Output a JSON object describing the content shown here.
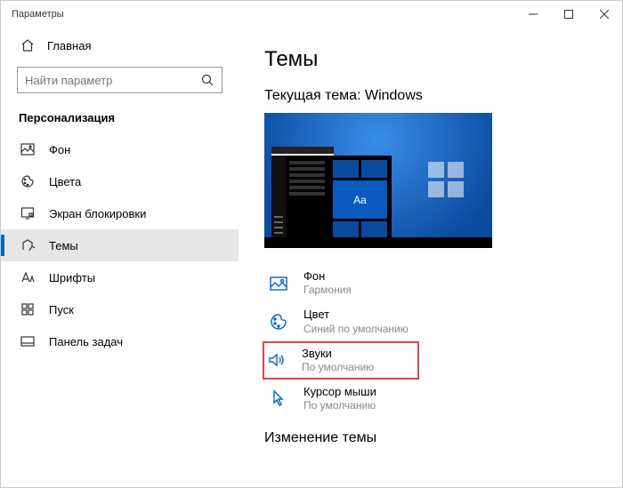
{
  "window": {
    "title": "Параметры"
  },
  "sidebar": {
    "home": "Главная",
    "search_placeholder": "Найти параметр",
    "category": "Персонализация",
    "items": [
      {
        "label": "Фон"
      },
      {
        "label": "Цвета"
      },
      {
        "label": "Экран блокировки"
      },
      {
        "label": "Темы"
      },
      {
        "label": "Шрифты"
      },
      {
        "label": "Пуск"
      },
      {
        "label": "Панель задач"
      }
    ]
  },
  "content": {
    "title": "Темы",
    "current_theme_label": "Текущая тема: Windows",
    "preview_tile_text": "Aa",
    "settings": [
      {
        "label": "Фон",
        "value": "Гармония"
      },
      {
        "label": "Цвет",
        "value": "Синий по умолчанию"
      },
      {
        "label": "Звуки",
        "value": "По умолчанию"
      },
      {
        "label": "Курсор мыши",
        "value": "По умолчанию"
      }
    ],
    "change_theme_heading": "Изменение темы"
  }
}
